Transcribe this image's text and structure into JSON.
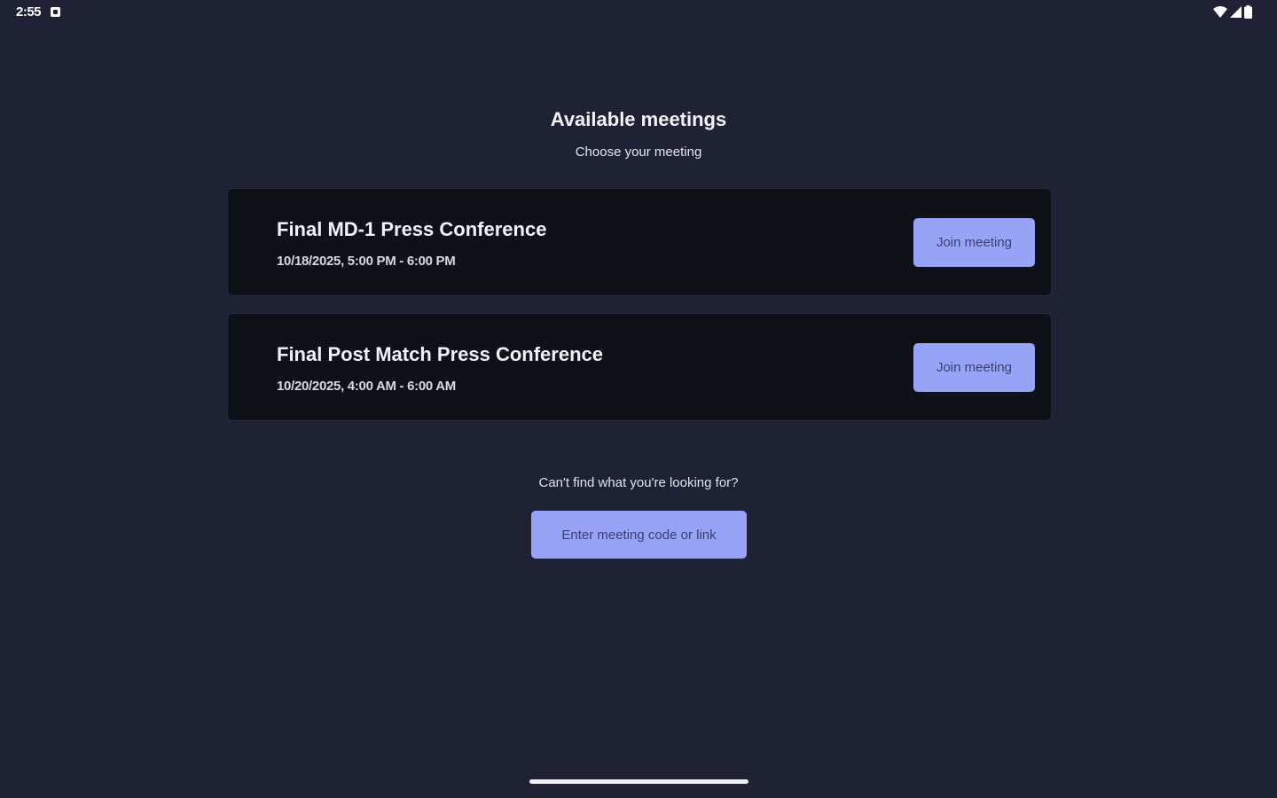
{
  "status_bar": {
    "time": "2:55",
    "icons": [
      "notification-icon",
      "wifi-icon",
      "signal-icon",
      "battery-icon"
    ]
  },
  "header": {
    "title": "Available meetings",
    "subtitle": "Choose your meeting"
  },
  "meetings": [
    {
      "title": "Final MD-1 Press Conference",
      "time": "10/18/2025, 5:00 PM - 6:00 PM",
      "join_label": "Join meeting"
    },
    {
      "title": "Final Post Match Press Conference",
      "time": "10/20/2025, 4:00 AM - 6:00 AM",
      "join_label": "Join meeting"
    }
  ],
  "footer": {
    "help_text": "Can't find what you're looking for?",
    "code_button_label": "Enter meeting code or link"
  },
  "colors": {
    "background": "#1f2235",
    "card": "#0f1119",
    "accent": "#97a3f6",
    "button_text": "#3a4070"
  }
}
